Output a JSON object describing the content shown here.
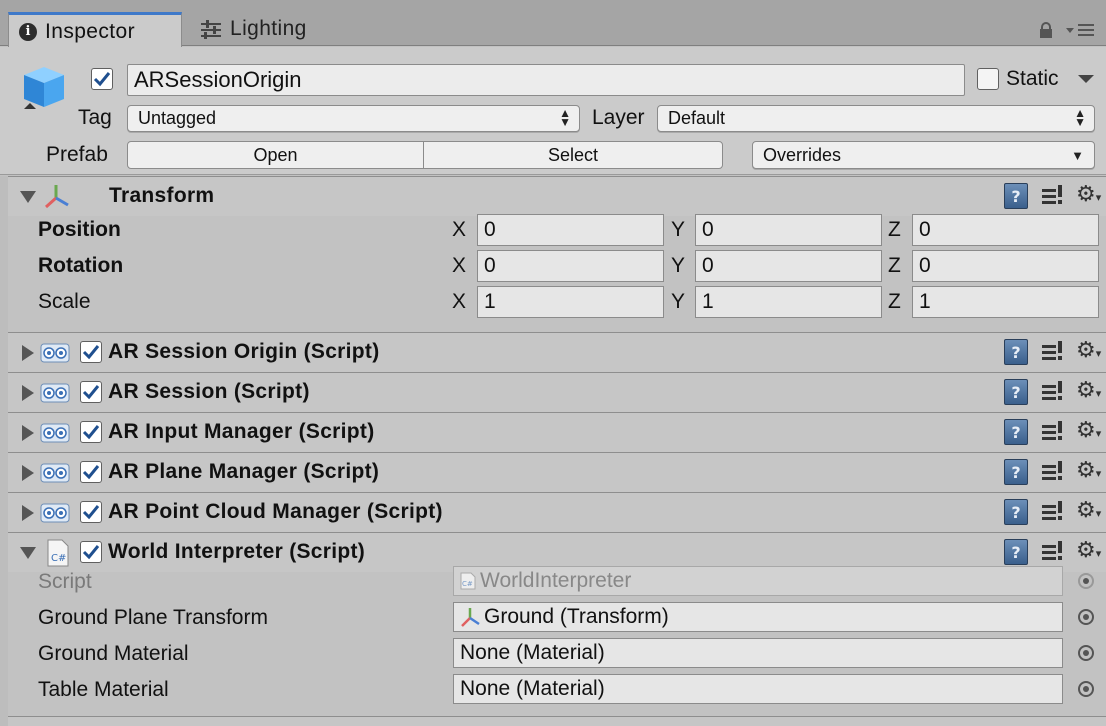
{
  "tabs": [
    {
      "label": "Inspector",
      "icon": "info-icon",
      "active": true
    },
    {
      "label": "Lighting",
      "icon": "lighting-sliders-icon",
      "active": false
    }
  ],
  "header": {
    "object_name": "ARSessionOrigin",
    "active_checked": true,
    "static_label": "Static",
    "static_checked": false,
    "tag_label": "Tag",
    "tag_value": "Untagged",
    "layer_label": "Layer",
    "layer_value": "Default",
    "prefab_label": "Prefab",
    "open_label": "Open",
    "select_label": "Select",
    "overrides_label": "Overrides"
  },
  "transform": {
    "title": "Transform",
    "rows": [
      {
        "label": "Position",
        "x": "0",
        "y": "0",
        "z": "0",
        "bold": true
      },
      {
        "label": "Rotation",
        "x": "0",
        "y": "0",
        "z": "0",
        "bold": true
      },
      {
        "label": "Scale",
        "x": "1",
        "y": "1",
        "z": "1",
        "bold": false
      }
    ],
    "axis": {
      "x": "X",
      "y": "Y",
      "z": "Z"
    }
  },
  "components": [
    {
      "title": "AR Session Origin (Script)",
      "enabled": true
    },
    {
      "title": "AR Session (Script)",
      "enabled": true
    },
    {
      "title": "AR Input Manager (Script)",
      "enabled": true
    },
    {
      "title": "AR Plane Manager (Script)",
      "enabled": true
    },
    {
      "title": "AR Point Cloud Manager (Script)",
      "enabled": true
    }
  ],
  "world_interpreter": {
    "title": "World Interpreter (Script)",
    "icon_text": "C#",
    "fields": [
      {
        "label": "Script",
        "value": "WorldInterpreter",
        "disabled": true
      },
      {
        "label": "Ground Plane Transform",
        "value": "Ground (Transform)"
      },
      {
        "label": "Ground Material",
        "value": "None (Material)"
      },
      {
        "label": "Table Material",
        "value": "None (Material)"
      }
    ]
  },
  "icons": {
    "help": "?",
    "gear": "⚙"
  },
  "colors": {
    "accent_tab": "#3e79c9",
    "panel": "#c2c2c2",
    "checkbox_mark": "#1f5fb3"
  }
}
